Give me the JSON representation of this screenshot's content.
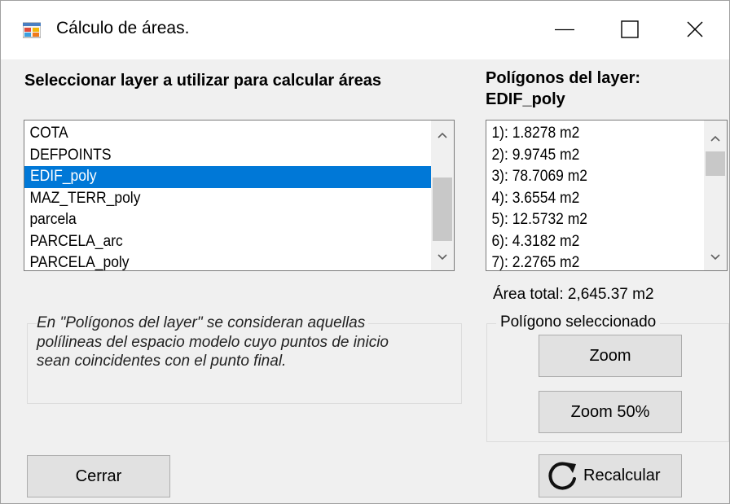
{
  "window": {
    "title": "Cálculo de áreas."
  },
  "layers": {
    "heading": "Seleccionar layer a utilizar para calcular áreas",
    "items": [
      "COTA",
      "DEFPOINTS",
      "EDIF_poly",
      "MAZ_TERR_poly",
      "parcela",
      "PARCELA_arc",
      "PARCELA_poly"
    ],
    "selected": "EDIF_poly"
  },
  "polygons": {
    "heading_line1": "Polígonos del layer:",
    "heading_line2": "EDIF_poly",
    "items": [
      "1): 1.8278 m2",
      "2): 9.9745 m2",
      "3): 78.7069 m2",
      "4): 3.6554 m2",
      "5): 12.5732 m2",
      "6): 4.3182 m2",
      "7): 2.2765 m2"
    ],
    "total": "Área total: 2,645.37 m2"
  },
  "note": {
    "line1": "En \"Polígonos del layer\" se consideran aquellas",
    "line2": "polílineas del espacio modelo cuyo puntos de inicio",
    "line3": "sean coincidentes con el punto final."
  },
  "selected_polygon": {
    "legend": "Polígono seleccionado",
    "zoom_label": "Zoom",
    "zoom50_label": "Zoom 50%"
  },
  "footer": {
    "close_label": "Cerrar",
    "recalc_label": "Recalcular"
  },
  "colors": {
    "selection": "#0078d7",
    "button_face": "#e1e1e1",
    "window_bg": "#f0f0f0"
  }
}
